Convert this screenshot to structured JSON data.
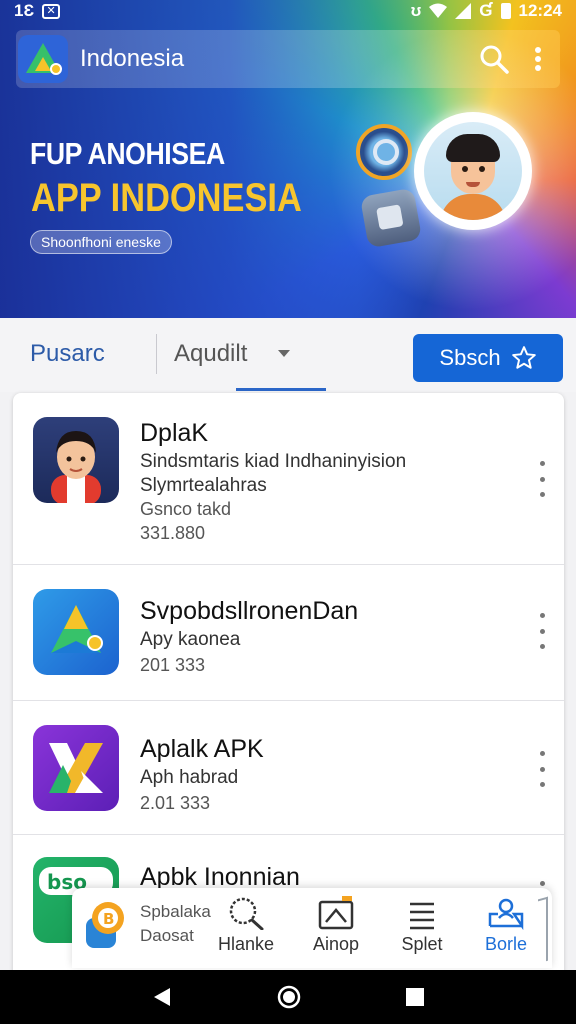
{
  "status_bar": {
    "left_text": "1Ɛ",
    "right_time": "12:24"
  },
  "app_bar": {
    "title": "Indonesia"
  },
  "banner": {
    "line1": "FUP ANOHISEA",
    "line2": "APP INDONESIA",
    "chip": "Shoonfhoni eneske"
  },
  "filter_bar": {
    "tab_label": "Pusarc",
    "sort_label": "Aqudilt",
    "search_button": "Sbsch"
  },
  "apps": [
    {
      "title": "DplaK",
      "subtitle": "Sindsmtaris kiad Indhaninyision",
      "subtitle2": "Slymrtealahras",
      "meta": "Gsnco takd",
      "count": "331.880"
    },
    {
      "title": "SvpobdsllronenDan",
      "subtitle": "Apy kaonea",
      "count": "201 333"
    },
    {
      "title": "Aplalk APK",
      "subtitle": "Aph habrad",
      "count": "2.01 333"
    },
    {
      "title": "Apbk Inonnian",
      "subtitle": "Spbalaka",
      "subtitle2": "Daosat"
    }
  ],
  "bottom_nav": {
    "promo_line1": "Spbalaka",
    "promo_line2": "Daosat",
    "items": [
      {
        "label": "Hlanke",
        "icon": "search-icon"
      },
      {
        "label": "Ainop",
        "icon": "image-upload-icon"
      },
      {
        "label": "Splet",
        "icon": "menu-lines-icon"
      },
      {
        "label": "Borle",
        "icon": "profile-box-icon"
      }
    ],
    "active_index": 3
  },
  "colors": {
    "accent": "#1566d6",
    "banner_yellow": "#f7c52e",
    "tab_blue": "#2d5ba8"
  }
}
